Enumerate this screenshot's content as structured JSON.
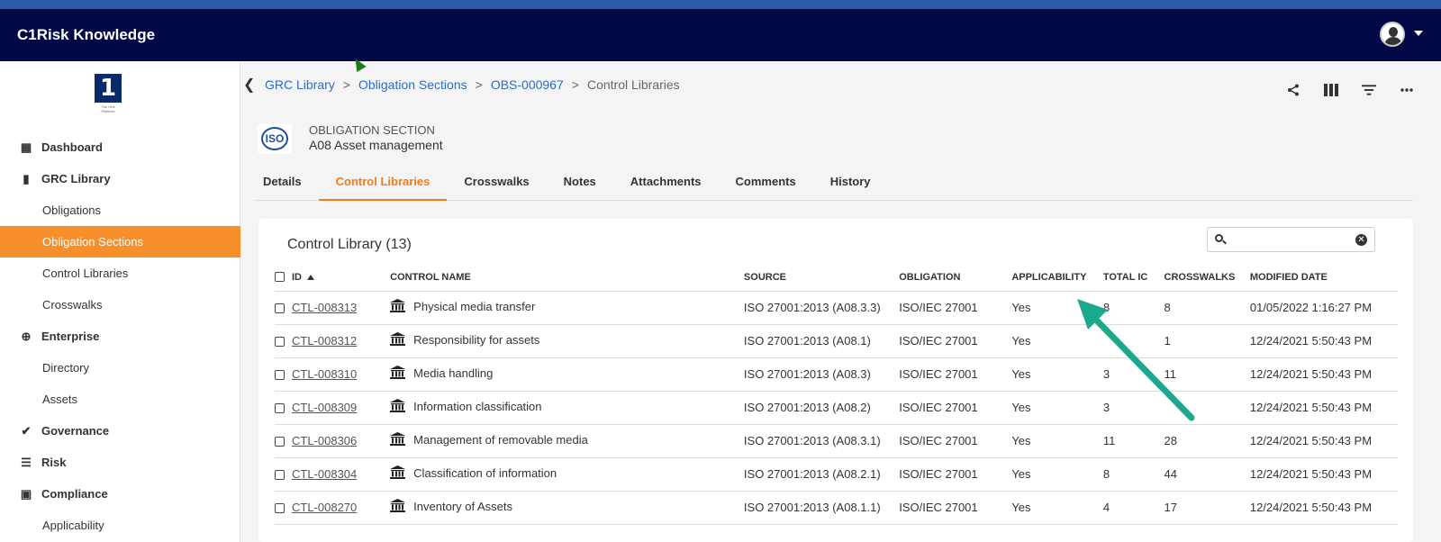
{
  "app": {
    "title": "C1Risk Knowledge"
  },
  "sidebar": {
    "logo_tagline": "The One Platform",
    "items": [
      {
        "label": "Dashboard",
        "type": "parent",
        "icon": "dashboard-icon"
      },
      {
        "label": "GRC Library",
        "type": "parent",
        "icon": "book-icon"
      },
      {
        "label": "Obligations",
        "type": "child"
      },
      {
        "label": "Obligation Sections",
        "type": "child",
        "active": true
      },
      {
        "label": "Control Libraries",
        "type": "child"
      },
      {
        "label": "Crosswalks",
        "type": "child"
      },
      {
        "label": "Enterprise",
        "type": "parent",
        "icon": "globe-icon"
      },
      {
        "label": "Directory",
        "type": "child"
      },
      {
        "label": "Assets",
        "type": "child"
      },
      {
        "label": "Governance",
        "type": "parent",
        "icon": "double-check-icon"
      },
      {
        "label": "Risk",
        "type": "parent",
        "icon": "list-icon"
      },
      {
        "label": "Compliance",
        "type": "parent",
        "icon": "clipboard-check-icon"
      },
      {
        "label": "Applicability",
        "type": "child"
      }
    ]
  },
  "breadcrumb": {
    "items": [
      "GRC Library",
      "Obligation Sections",
      "OBS-000967",
      "Control Libraries"
    ],
    "separator": ">"
  },
  "toolbar": [
    "share-icon",
    "columns-icon",
    "filter-icon",
    "more-icon"
  ],
  "record": {
    "icon_text": "ISO",
    "type": "OBLIGATION SECTION",
    "name": "A08 Asset management"
  },
  "tabs": [
    "Details",
    "Control Libraries",
    "Crosswalks",
    "Notes",
    "Attachments",
    "Comments",
    "History"
  ],
  "active_tab": 1,
  "panel": {
    "title": "Control Library (13)",
    "search": {
      "value": "",
      "placeholder": ""
    }
  },
  "table": {
    "columns": [
      "ID",
      "CONTROL NAME",
      "SOURCE",
      "OBLIGATION",
      "APPLICABILITY",
      "TOTAL IC",
      "CROSSWALKS",
      "MODIFIED DATE"
    ],
    "rows": [
      {
        "id": "CTL-008313",
        "name": "Physical media transfer",
        "source": "ISO 27001:2013 (A08.3.3)",
        "obligation": "ISO/IEC 27001",
        "applicability": "Yes",
        "total_ic": "8",
        "crosswalks": "8",
        "modified": "01/05/2022 1:16:27 PM"
      },
      {
        "id": "CTL-008312",
        "name": "Responsibility for assets",
        "source": "ISO 27001:2013 (A08.1)",
        "obligation": "ISO/IEC 27001",
        "applicability": "Yes",
        "total_ic": "",
        "crosswalks": "1",
        "modified": "12/24/2021 5:50:43 PM"
      },
      {
        "id": "CTL-008310",
        "name": "Media handling",
        "source": "ISO 27001:2013 (A08.3)",
        "obligation": "ISO/IEC 27001",
        "applicability": "Yes",
        "total_ic": "3",
        "crosswalks": "11",
        "modified": "12/24/2021 5:50:43 PM"
      },
      {
        "id": "CTL-008309",
        "name": "Information classification",
        "source": "ISO 27001:2013 (A08.2)",
        "obligation": "ISO/IEC 27001",
        "applicability": "Yes",
        "total_ic": "3",
        "crosswalks": "",
        "modified": "12/24/2021 5:50:43 PM"
      },
      {
        "id": "CTL-008306",
        "name": "Management of removable media",
        "source": "ISO 27001:2013 (A08.3.1)",
        "obligation": "ISO/IEC 27001",
        "applicability": "Yes",
        "total_ic": "11",
        "crosswalks": "28",
        "modified": "12/24/2021 5:50:43 PM"
      },
      {
        "id": "CTL-008304",
        "name": "Classification of information",
        "source": "ISO 27001:2013 (A08.2.1)",
        "obligation": "ISO/IEC 27001",
        "applicability": "Yes",
        "total_ic": "8",
        "crosswalks": "44",
        "modified": "12/24/2021 5:50:43 PM"
      },
      {
        "id": "CTL-008270",
        "name": "Inventory of Assets",
        "source": "ISO 27001:2013 (A08.1.1)",
        "obligation": "ISO/IEC 27001",
        "applicability": "Yes",
        "total_ic": "4",
        "crosswalks": "17",
        "modified": "12/24/2021 5:50:43 PM"
      }
    ]
  },
  "colors": {
    "topbar": "#020946",
    "accent": "#f7902a",
    "link": "#2a6dc8",
    "annotation_arrow": "#1aa98a"
  }
}
